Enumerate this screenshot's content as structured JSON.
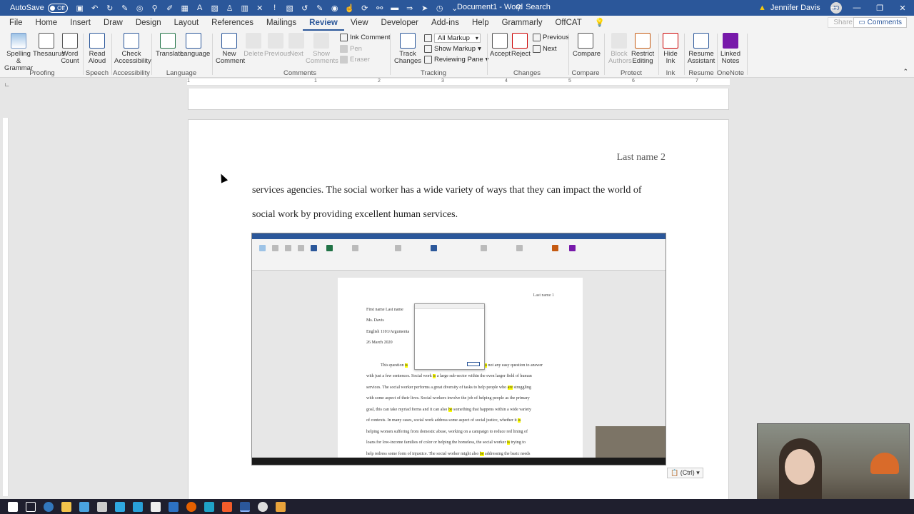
{
  "titlebar": {
    "autosave_label": "AutoSave",
    "autosave_state": "Off",
    "doc_title": "Document1 - Word",
    "search_label": "Search",
    "user_name": "Jennifer Davis",
    "user_initials": "JD",
    "warning_icon": "warning-icon"
  },
  "tabs": [
    "File",
    "Home",
    "Insert",
    "Draw",
    "Design",
    "Layout",
    "References",
    "Mailings",
    "Review",
    "View",
    "Developer",
    "Add-ins",
    "Help",
    "Grammarly",
    "OffCAT"
  ],
  "active_tab": "Review",
  "share_label": "Share",
  "comments_label": "Comments",
  "ribbon": {
    "spelling": "Spelling &\nGrammar",
    "thesaurus": "Thesaurus",
    "word_count": "Word\nCount",
    "read_aloud": "Read\nAloud",
    "check_accessibility": "Check\nAccessibility",
    "translate": "Translate",
    "language": "Language",
    "new_comment": "New\nComment",
    "delete": "Delete",
    "previous": "Previous",
    "next": "Next",
    "show_comments": "Show\nComments",
    "ink_comment": "Ink Comment",
    "pen": "Pen",
    "eraser": "Eraser",
    "track_changes": "Track\nChanges",
    "all_markup": "All Markup",
    "show_markup": "Show Markup",
    "reviewing_pane": "Reviewing Pane",
    "accept": "Accept",
    "reject": "Reject",
    "prev_change": "Previous",
    "next_change": "Next",
    "compare": "Compare",
    "block_authors": "Block\nAuthors",
    "restrict_editing": "Restrict\nEditing",
    "hide_ink": "Hide\nInk",
    "resume_assistant": "Resume\nAssistant",
    "linked_notes": "Linked\nNotes",
    "groups": {
      "proofing": "Proofing",
      "speech": "Speech",
      "accessibility": "Accessibility",
      "language": "Language",
      "comments": "Comments",
      "tracking": "Tracking",
      "changes": "Changes",
      "compare": "Compare",
      "protect": "Protect",
      "ink": "Ink",
      "resume": "Resume",
      "onenote": "OneNote"
    }
  },
  "ruler_numbers": [
    "1",
    "1",
    "2",
    "3",
    "4",
    "5",
    "6",
    "7"
  ],
  "page": {
    "header": "Last name 2",
    "line1": "services agencies. The social worker has a wide variety of ways that they can impact the world of",
    "line2": "social work by providing excellent human services."
  },
  "embedded": {
    "header": "Last name 1",
    "name": "First name Last name",
    "teacher": "Ms. Davis",
    "course": "English 1101/Argumenta",
    "date": "26 March 2020",
    "p1": "This question",
    "p1b": "not any easy question to answer",
    "p2": "with just a few sentences. Social work",
    "p2b": "a large sub-sector within the even larger field of human",
    "p3": "services. The social worker performs a great diversity of tasks to help people who",
    "p3b": "struggling",
    "p4": "with some aspect of their lives. Social workers involve the job of helping people as the primary",
    "p5": "goal, this can take myriad forms and it can also",
    "p5b": "something that happens within a wide variety",
    "p6": "of contexts. In many cases, social work address some aspect of social justice, whether it",
    "p7": "helping women suffering from domestic abuse, working on a campaign to reduce red lining of",
    "p8": "loans for low-income families of color or helping the homeless, the social worker",
    "p8b": "trying to",
    "p9": "help redress some form of injustice. The social worker might also",
    "p9b": "addressing the basic needs",
    "hl_is": "is",
    "hl_are": "are",
    "hl_be": "be"
  },
  "paste_options": "(Ctrl)",
  "colors": {
    "word_blue": "#2b579a",
    "ribbon_bg": "#f3f3f3",
    "highlight": "#ffff00"
  }
}
